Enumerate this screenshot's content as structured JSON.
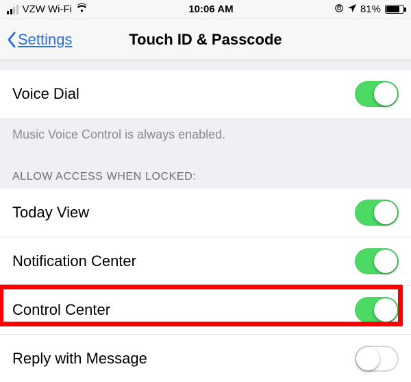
{
  "statusbar": {
    "carrier": "VZW Wi-Fi",
    "time": "10:06 AM",
    "battery_pct": "81%",
    "battery_fill_pct": 81
  },
  "nav": {
    "back_label": "Settings",
    "title": "Touch ID & Passcode"
  },
  "voice_dial": {
    "label": "Voice Dial",
    "on": true,
    "footer": "Music Voice Control is always enabled."
  },
  "allow_access_header": "ALLOW ACCESS WHEN LOCKED:",
  "allow_access": [
    {
      "key": "today",
      "label": "Today View",
      "on": true,
      "highlight": false
    },
    {
      "key": "notif",
      "label": "Notification Center",
      "on": true,
      "highlight": false
    },
    {
      "key": "control",
      "label": "Control Center",
      "on": true,
      "highlight": true
    },
    {
      "key": "reply",
      "label": "Reply with Message",
      "on": false,
      "highlight": false
    }
  ]
}
